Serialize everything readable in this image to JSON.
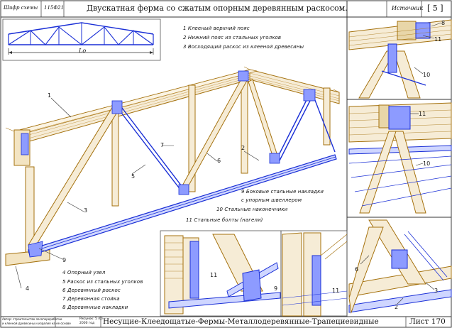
{
  "header": {
    "code_label": "Шифр схемы",
    "code_value": "115Ф21",
    "title": "Двускатная ферма со сжатым опорным деревянным раскосом.",
    "source_label": "Источник",
    "source_value": "[ 5 ]"
  },
  "scheme": {
    "span_label": "Lo"
  },
  "legend_top": [
    "1   Клееный верхний пояс",
    "2   Нижний пояс из стальных уголков",
    "3   Восходящий раскос из клееной древесины"
  ],
  "legend_mid": [
    "9   Боковые стальные накладки",
    "     с упорным швеллером",
    "10   Стальные наконечники",
    "11   Стальные болты (нагели)"
  ],
  "legend_bottom": [
    "4   Опорный узел",
    "5   Раскос из стальных уголков",
    "6   Деревянный раскос",
    "7   Деревянная стойка",
    "8   Деревянные накладки"
  ],
  "callouts": {
    "main": [
      "1",
      "2",
      "3",
      "4",
      "5",
      "6",
      "7",
      "9"
    ],
    "detail_top": [
      "8",
      "11",
      "10"
    ],
    "detail_mid": [
      "11",
      "10"
    ],
    "detail_bottom_left": [
      "11",
      "9",
      "11"
    ],
    "detail_bottom_right": [
      "6",
      "3",
      "2"
    ]
  },
  "footer": {
    "author_note_1": "Автор: строительство лесопереработки",
    "author_note_2": "и клееной древесины и изделия на ее основе",
    "date_note_1": "Рисунок: 5 (0)",
    "date_note_2": "2000 год",
    "title": "Несущие-Клеедощатые-Фермы-Металлодеревянные-Трапециевидные",
    "sheet_label": "Лист 170"
  },
  "colors": {
    "steel": "#1a2fd6",
    "timber": "#a5720f",
    "ink": "#222222"
  }
}
